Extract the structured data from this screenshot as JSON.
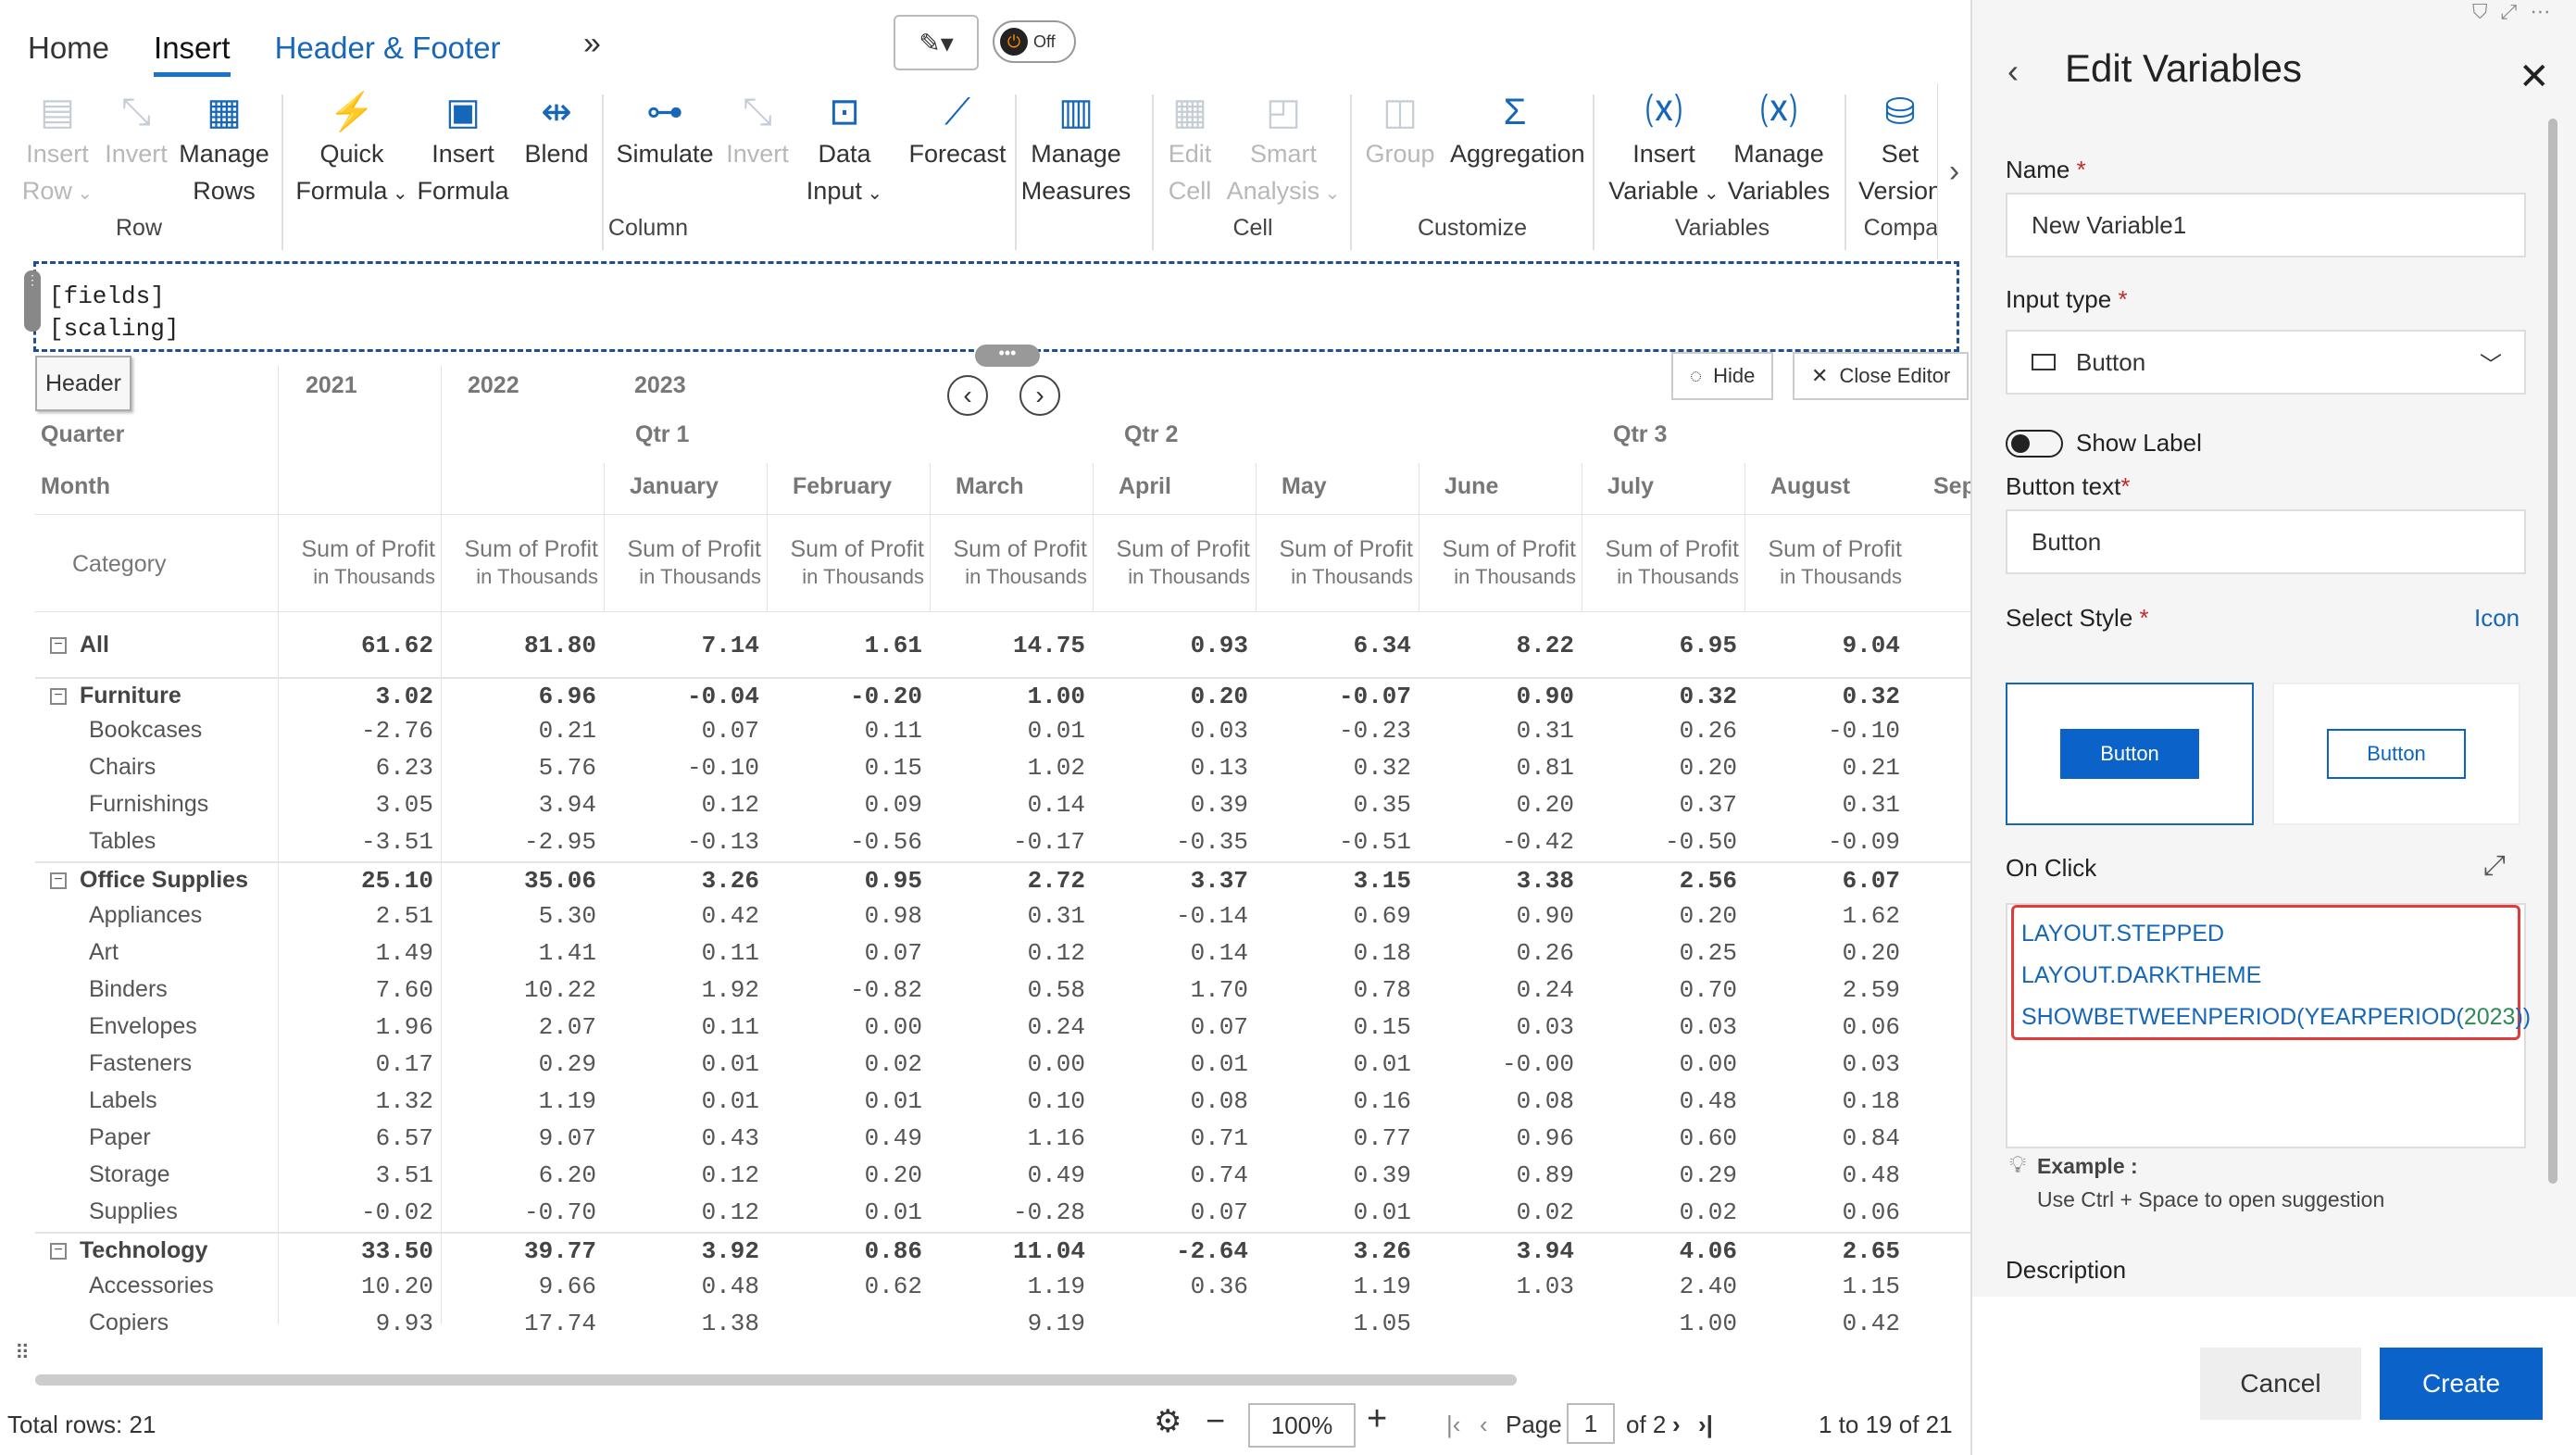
{
  "tabs": [
    "Home",
    "Insert",
    "Header & Footer"
  ],
  "toolbar": {
    "more_icon": "chevrons-right-icon",
    "toggle_label": "Off"
  },
  "ribbon": {
    "buttons": [
      {
        "line1": "Insert",
        "line2": "Row",
        "caret": true,
        "disabled": true,
        "icon": "▤"
      },
      {
        "line1": "Invert",
        "line2": "",
        "caret": false,
        "disabled": true,
        "icon": "⤡"
      },
      {
        "line1": "Manage",
        "line2": "Rows",
        "caret": false,
        "disabled": false,
        "icon": "▦"
      },
      {
        "line1": "Quick",
        "line2": "Formula",
        "caret": true,
        "disabled": false,
        "icon": "⚡"
      },
      {
        "line1": "Insert",
        "line2": "Formula",
        "caret": false,
        "disabled": false,
        "icon": "▣"
      },
      {
        "line1": "Blend",
        "line2": "",
        "caret": false,
        "disabled": false,
        "icon": "⇹"
      },
      {
        "line1": "Simulate",
        "line2": "",
        "caret": false,
        "disabled": false,
        "icon": "⊶"
      },
      {
        "line1": "Invert",
        "line2": "",
        "caret": false,
        "disabled": true,
        "icon": "⤡"
      },
      {
        "line1": "Data",
        "line2": "Input",
        "caret": true,
        "disabled": false,
        "icon": "⊡"
      },
      {
        "line1": "Forecast",
        "line2": "",
        "caret": false,
        "disabled": false,
        "icon": "⟋"
      },
      {
        "line1": "Manage",
        "line2": "Measures",
        "caret": false,
        "disabled": false,
        "icon": "▥"
      },
      {
        "line1": "Edit",
        "line2": "Cell",
        "caret": false,
        "disabled": true,
        "icon": "▦"
      },
      {
        "line1": "Smart",
        "line2": "Analysis",
        "caret": true,
        "disabled": true,
        "icon": "◰"
      },
      {
        "line1": "Group",
        "line2": "",
        "caret": false,
        "disabled": true,
        "icon": "◫"
      },
      {
        "line1": "Aggregation",
        "line2": "",
        "caret": false,
        "disabled": false,
        "icon": "Σ"
      },
      {
        "line1": "Insert",
        "line2": "Variable",
        "caret": true,
        "disabled": false,
        "icon": "⒳"
      },
      {
        "line1": "Manage",
        "line2": "Variables",
        "caret": false,
        "disabled": false,
        "icon": "⒳"
      },
      {
        "line1": "Set",
        "line2": "Version",
        "caret": false,
        "disabled": false,
        "icon": "⛁"
      }
    ],
    "groups": [
      "Row",
      "Column",
      "Cell",
      "Customize",
      "Variables",
      "Compare"
    ]
  },
  "editor": {
    "line1": "[fields]",
    "line2": "[scaling]",
    "hide": "Hide",
    "close": "Close Editor"
  },
  "grid": {
    "header_button": "Header",
    "row_headers": [
      "Quarter",
      "Month",
      "Category"
    ],
    "years": [
      "2021",
      "2022",
      "2023"
    ],
    "quarters": [
      "Qtr 1",
      "Qtr 2",
      "Qtr 3"
    ],
    "months": [
      "January",
      "February",
      "March",
      "April",
      "May",
      "June",
      "July",
      "August",
      "Sep"
    ],
    "measure": "Sum of Profit",
    "measure_sub": "in Thousands",
    "rows": [
      {
        "label": "All",
        "level": 0,
        "bold": true,
        "toggle": "−",
        "values": [
          "61.62",
          "81.80",
          "7.14",
          "1.61",
          "14.75",
          "0.93",
          "6.34",
          "8.22",
          "6.95",
          "9.04"
        ]
      },
      {
        "label": "Furniture",
        "level": 0,
        "bold": true,
        "toggle": "−",
        "values": [
          "3.02",
          "6.96",
          "-0.04",
          "-0.20",
          "1.00",
          "0.20",
          "-0.07",
          "0.90",
          "0.32",
          "0.32"
        ]
      },
      {
        "label": "Bookcases",
        "level": 1,
        "bold": false,
        "values": [
          "-2.76",
          "0.21",
          "0.07",
          "0.11",
          "0.01",
          "0.03",
          "-0.23",
          "0.31",
          "0.26",
          "-0.10"
        ]
      },
      {
        "label": "Chairs",
        "level": 1,
        "bold": false,
        "values": [
          "6.23",
          "5.76",
          "-0.10",
          "0.15",
          "1.02",
          "0.13",
          "0.32",
          "0.81",
          "0.20",
          "0.21"
        ]
      },
      {
        "label": "Furnishings",
        "level": 1,
        "bold": false,
        "values": [
          "3.05",
          "3.94",
          "0.12",
          "0.09",
          "0.14",
          "0.39",
          "0.35",
          "0.20",
          "0.37",
          "0.31"
        ]
      },
      {
        "label": "Tables",
        "level": 1,
        "bold": false,
        "values": [
          "-3.51",
          "-2.95",
          "-0.13",
          "-0.56",
          "-0.17",
          "-0.35",
          "-0.51",
          "-0.42",
          "-0.50",
          "-0.09"
        ]
      },
      {
        "label": "Office Supplies",
        "level": 0,
        "bold": true,
        "toggle": "−",
        "values": [
          "25.10",
          "35.06",
          "3.26",
          "0.95",
          "2.72",
          "3.37",
          "3.15",
          "3.38",
          "2.56",
          "6.07"
        ]
      },
      {
        "label": "Appliances",
        "level": 1,
        "bold": false,
        "values": [
          "2.51",
          "5.30",
          "0.42",
          "0.98",
          "0.31",
          "-0.14",
          "0.69",
          "0.90",
          "0.20",
          "1.62"
        ]
      },
      {
        "label": "Art",
        "level": 1,
        "bold": false,
        "values": [
          "1.49",
          "1.41",
          "0.11",
          "0.07",
          "0.12",
          "0.14",
          "0.18",
          "0.26",
          "0.25",
          "0.20"
        ]
      },
      {
        "label": "Binders",
        "level": 1,
        "bold": false,
        "values": [
          "7.60",
          "10.22",
          "1.92",
          "-0.82",
          "0.58",
          "1.70",
          "0.78",
          "0.24",
          "0.70",
          "2.59"
        ]
      },
      {
        "label": "Envelopes",
        "level": 1,
        "bold": false,
        "values": [
          "1.96",
          "2.07",
          "0.11",
          "0.00",
          "0.24",
          "0.07",
          "0.15",
          "0.03",
          "0.03",
          "0.06"
        ]
      },
      {
        "label": "Fasteners",
        "level": 1,
        "bold": false,
        "values": [
          "0.17",
          "0.29",
          "0.01",
          "0.02",
          "0.00",
          "0.01",
          "0.01",
          "-0.00",
          "0.00",
          "0.03"
        ]
      },
      {
        "label": "Labels",
        "level": 1,
        "bold": false,
        "values": [
          "1.32",
          "1.19",
          "0.01",
          "0.01",
          "0.10",
          "0.08",
          "0.16",
          "0.08",
          "0.48",
          "0.18"
        ]
      },
      {
        "label": "Paper",
        "level": 1,
        "bold": false,
        "values": [
          "6.57",
          "9.07",
          "0.43",
          "0.49",
          "1.16",
          "0.71",
          "0.77",
          "0.96",
          "0.60",
          "0.84"
        ]
      },
      {
        "label": "Storage",
        "level": 1,
        "bold": false,
        "values": [
          "3.51",
          "6.20",
          "0.12",
          "0.20",
          "0.49",
          "0.74",
          "0.39",
          "0.89",
          "0.29",
          "0.48"
        ]
      },
      {
        "label": "Supplies",
        "level": 1,
        "bold": false,
        "values": [
          "-0.02",
          "-0.70",
          "0.12",
          "0.01",
          "-0.28",
          "0.07",
          "0.01",
          "0.02",
          "0.02",
          "0.06"
        ]
      },
      {
        "label": "Technology",
        "level": 0,
        "bold": true,
        "toggle": "−",
        "values": [
          "33.50",
          "39.77",
          "3.92",
          "0.86",
          "11.04",
          "-2.64",
          "3.26",
          "3.94",
          "4.06",
          "2.65"
        ]
      },
      {
        "label": "Accessories",
        "level": 1,
        "bold": false,
        "values": [
          "10.20",
          "9.66",
          "0.48",
          "0.62",
          "1.19",
          "0.36",
          "1.19",
          "1.03",
          "2.40",
          "1.15"
        ]
      },
      {
        "label": "Copiers",
        "level": 1,
        "bold": false,
        "values": [
          "9.93",
          "17.74",
          "1.38",
          "",
          "9.19",
          "",
          "1.05",
          "",
          "1.00",
          "0.42"
        ]
      }
    ]
  },
  "status": {
    "total": "Total rows: 21",
    "zoom": "100%",
    "page_label": "Page",
    "page": "1",
    "of": "of 2",
    "range": "1  to  19  of  21"
  },
  "panel": {
    "title": "Edit Variables",
    "name_label": "Name",
    "name_value": "New Variable1",
    "input_type_label": "Input type",
    "input_type_value": "Button",
    "show_label": "Show Label",
    "button_text_label": "Button text",
    "button_text_value": "Button",
    "select_style_label": "Select Style",
    "icon_link": "Icon",
    "style_options": [
      "Button",
      "Button"
    ],
    "on_click_label": "On Click",
    "code": [
      "LAYOUT.STEPPED",
      "LAYOUT.DARKTHEME"
    ],
    "code3a": "SHOWBETWEENPERIOD(YEARPERIOD(",
    "code3num": "2023",
    "code3b": "))",
    "example_label": "Example",
    "hint": "Use Ctrl + Space to open suggestion",
    "description_label": "Description",
    "cancel": "Cancel",
    "create": "Create"
  }
}
